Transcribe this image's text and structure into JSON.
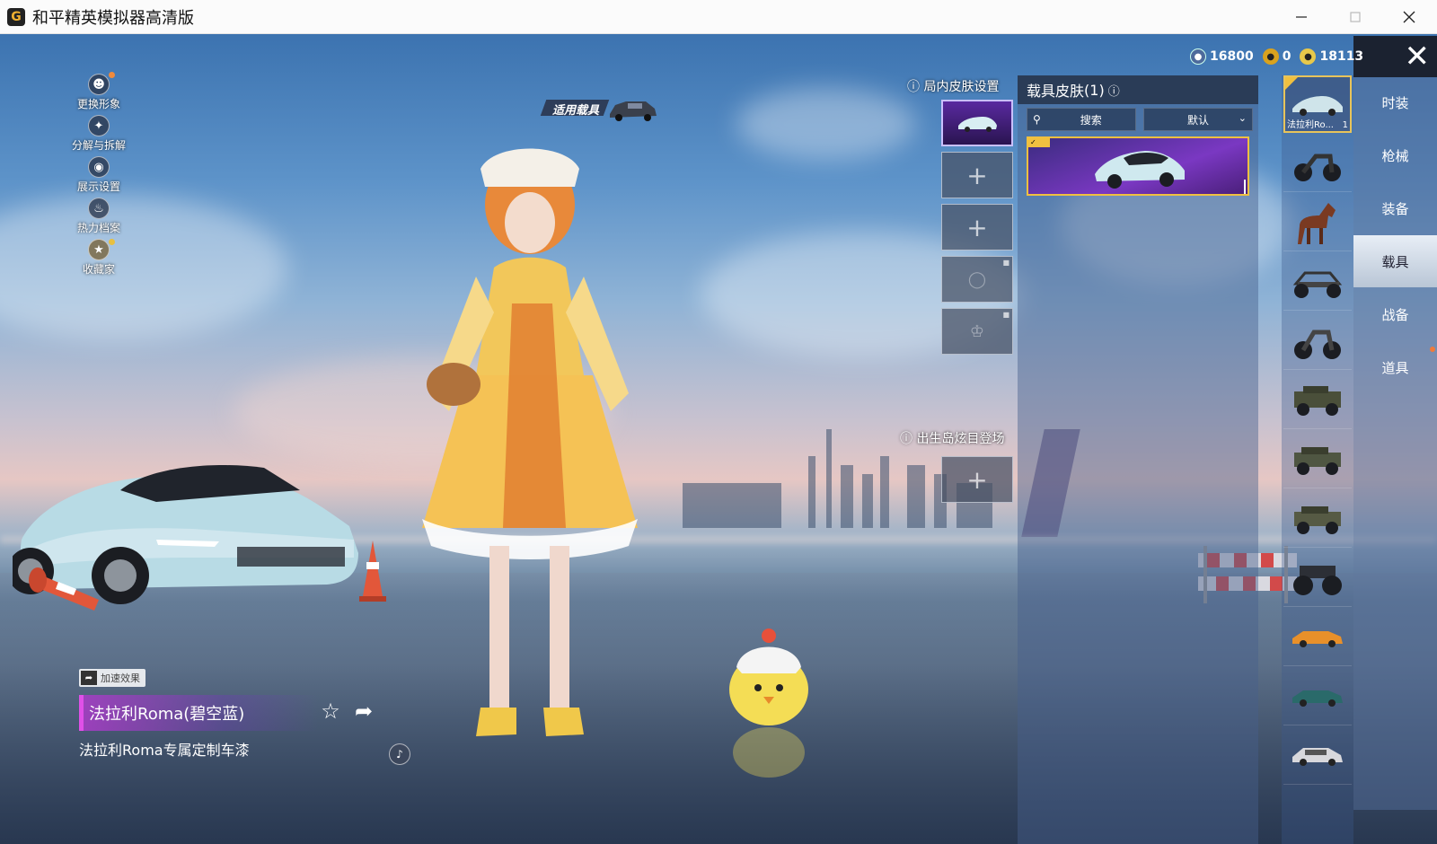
{
  "window": {
    "title": "和平精英模拟器高清版"
  },
  "left_menu": [
    {
      "label": "更换形象",
      "icon": "person-icon"
    },
    {
      "label": "分解与拆解",
      "icon": "puzzle-icon"
    },
    {
      "label": "展示设置",
      "icon": "eye-icon"
    },
    {
      "label": "热力档案",
      "icon": "flame-icon"
    },
    {
      "label": "收藏家",
      "icon": "medal-icon"
    }
  ],
  "scene": {
    "apply_vehicle": "适用载具"
  },
  "item": {
    "boost_badge": "加速效果",
    "name": "法拉利Roma(碧空蓝)",
    "description": "法拉利Roma专属定制车漆"
  },
  "ingame": {
    "label": "局内皮肤设置",
    "spawn_label": "出生岛炫目登场"
  },
  "vehicle_skin": {
    "title": "载具皮肤",
    "count": "(1)",
    "search_placeholder": "搜索",
    "sort": "默认"
  },
  "vehicle_list": [
    {
      "label": "法拉利Ro...",
      "count": "1",
      "icon": "sports-car-icon"
    },
    {
      "icon": "motorcycle-icon"
    },
    {
      "icon": "horse-icon"
    },
    {
      "icon": "buggy-icon"
    },
    {
      "icon": "motorcycle-icon"
    },
    {
      "icon": "jeep-icon"
    },
    {
      "icon": "jeep-icon"
    },
    {
      "icon": "jeep-icon"
    },
    {
      "icon": "monster-truck-icon"
    },
    {
      "icon": "muscle-car-icon"
    },
    {
      "icon": "coupe-icon"
    },
    {
      "icon": "sedan-icon"
    }
  ],
  "tabs": [
    "时装",
    "枪械",
    "装备",
    "载具",
    "战备",
    "道具"
  ],
  "active_tab": "载具",
  "currency": [
    {
      "value": "16800",
      "icon": "globe-coin-icon"
    },
    {
      "value": "0",
      "icon": "gold-coin-icon"
    },
    {
      "value": "18113",
      "icon": "token-coin-icon"
    }
  ],
  "colors": {
    "accent_gold": "#f0c040",
    "name_bar_purple": "#e050e8",
    "panel_dark": "#1b2230"
  }
}
